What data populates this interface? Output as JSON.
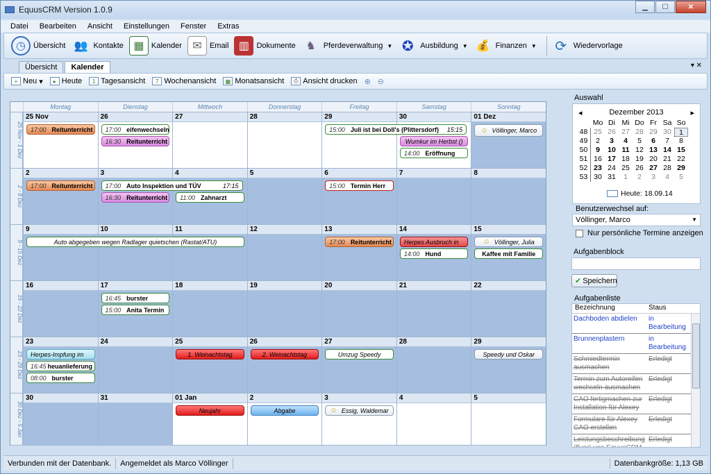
{
  "window": {
    "title": "EquusCRM  Version 1.0.9"
  },
  "menu": [
    "Datei",
    "Bearbeiten",
    "Ansicht",
    "Einstellungen",
    "Fenster",
    "Extras"
  ],
  "toolbar": {
    "items": [
      "Übersicht",
      "Kontakte",
      "Kalender",
      "Email",
      "Dokumente",
      "Pferdeverwaltung",
      "Ausbildung",
      "Finanzen",
      "Wiedervorlage"
    ]
  },
  "tabs": [
    "Übersicht",
    "Kalender"
  ],
  "subtoolbar": [
    "Neu",
    "Heute",
    "Tagesansicht",
    "Wochenansicht",
    "Monatsansicht",
    "Ansicht drucken"
  ],
  "calendar": {
    "weekdays": [
      "Montag",
      "Dienstag",
      "Mittwoch",
      "Donnerstag",
      "Freitag",
      "Samstag",
      "Sonntag"
    ],
    "weeks": [
      {
        "label": "25 Nov - 1 Dez",
        "days": [
          "25 Nov",
          "26",
          "27",
          "28",
          "29",
          "30",
          "01 Dez"
        ]
      },
      {
        "label": "2 - 8 Dez",
        "days": [
          "2",
          "3",
          "4",
          "5",
          "6",
          "7",
          "8"
        ]
      },
      {
        "label": "9 - 15 Dez",
        "days": [
          "9",
          "10",
          "11",
          "12",
          "13",
          "14",
          "15"
        ]
      },
      {
        "label": "16 - 22 Dez",
        "days": [
          "16",
          "17",
          "18",
          "19",
          "20",
          "21",
          "22"
        ]
      },
      {
        "label": "23 - 29 Dez",
        "days": [
          "23",
          "24",
          "25",
          "26",
          "27",
          "28",
          "29"
        ]
      },
      {
        "label": "30 Dez - 5 Jan",
        "days": [
          "30",
          "31",
          "01 Jan",
          "2",
          "3",
          "4",
          "5"
        ]
      }
    ],
    "events": {
      "w0_mo": {
        "time": "17:00",
        "text": "Reitunterricht"
      },
      "w0_di1": {
        "time": "17:00",
        "text": "eifenwechseln"
      },
      "w0_di2": {
        "time": "16:30",
        "text": "Reitunterricht"
      },
      "w0_fr": {
        "time": "15:00",
        "text": "Juli ist bei Doll's (Plittersdorf)",
        "end": "15:15"
      },
      "w0_sa1": {
        "text": "Wumkur im Herbst ()"
      },
      "w0_sa2": {
        "time": "14:00",
        "text": "Eröffnung"
      },
      "w0_so": {
        "text": "Völlinger, Marco"
      },
      "w1_mo": {
        "time": "17:00",
        "text": "Reitunterricht"
      },
      "w1_di1": {
        "time": "17:00",
        "text": "Auto Inspektion und TÜV",
        "end": "17:15"
      },
      "w1_di2": {
        "time": "16:30",
        "text": "Reitunterricht"
      },
      "w1_mi": {
        "time": "11:00",
        "text": "Zahnarzt"
      },
      "w1_fr": {
        "time": "15:00",
        "text": "Termin Herr"
      },
      "w2_span": {
        "text": "Auto abgegeben wegen Radlager quietschen (Rastat/ATU)"
      },
      "w2_fr": {
        "time": "17:00",
        "text": "Reitunterricht"
      },
      "w2_sa1": {
        "text": "Herpes Ausbruch in"
      },
      "w2_sa2": {
        "time": "14:00",
        "text": "Hund"
      },
      "w2_so1": {
        "text": "Völlinger, Julia"
      },
      "w2_so2": {
        "text": "Kaffee mit Familie"
      },
      "w3_di1": {
        "time": "16:45",
        "text": "burster"
      },
      "w3_di2": {
        "time": "15:00",
        "text": "Anita Termin"
      },
      "w4_mo1": {
        "text": "Herpes-Impfung im"
      },
      "w4_mo2": {
        "time": "16:45",
        "text": "heuanlieferung"
      },
      "w4_mo3": {
        "time": "08:00",
        "text": "burster"
      },
      "w4_mi": {
        "text": "1. Weinachtstag"
      },
      "w4_do": {
        "text": "2. Weinachtstag"
      },
      "w4_fr": {
        "text": "Umzug Speedy"
      },
      "w4_so": {
        "text": "Speedy und Oskar"
      },
      "w5_mi": {
        "text": "Neujahr"
      },
      "w5_do": {
        "text": "Abgabe"
      },
      "w5_fr": {
        "text": "Essig, Waldemar"
      }
    }
  },
  "sidebar": {
    "auswahl": "Auswahl",
    "month": "Dezember 2013",
    "mini_headers": [
      "Mo",
      "Di",
      "Mi",
      "Do",
      "Fr",
      "Sa",
      "So"
    ],
    "mini_rows": [
      {
        "wk": "48",
        "d": [
          "25",
          "26",
          "27",
          "28",
          "29",
          "30",
          "1"
        ]
      },
      {
        "wk": "49",
        "d": [
          "2",
          "3",
          "4",
          "5",
          "6",
          "7",
          "8"
        ]
      },
      {
        "wk": "50",
        "d": [
          "9",
          "10",
          "11",
          "12",
          "13",
          "14",
          "15"
        ]
      },
      {
        "wk": "51",
        "d": [
          "16",
          "17",
          "18",
          "19",
          "20",
          "21",
          "22"
        ]
      },
      {
        "wk": "52",
        "d": [
          "23",
          "24",
          "25",
          "26",
          "27",
          "28",
          "29"
        ]
      },
      {
        "wk": "53",
        "d": [
          "30",
          "31",
          "1",
          "2",
          "3",
          "4",
          "5"
        ]
      }
    ],
    "today": "Heute: 18.09.14",
    "user_label": "Benutzerwechsel auf:",
    "user_value": "Völlinger, Marco",
    "only_personal": "Nur persönliche Termine anzeigen",
    "taskblock": "Aufgabenblock",
    "save": "Speichern",
    "tasklist": "Aufgabenliste",
    "task_headers": [
      "Bezeichnung",
      "Staus"
    ],
    "tasks": [
      {
        "name": "Dachboden abdielen",
        "status": "in Bearbeitung",
        "state": "active"
      },
      {
        "name": "Brunnenplastern",
        "status": "in Bearbeitung",
        "state": "active"
      },
      {
        "name": "Schmiedtermin ausmachen",
        "status": "Erledigt",
        "state": "done"
      },
      {
        "name": "Termin zum Autoreifen wechseln ausmachen",
        "status": "Erledigt",
        "state": "done"
      },
      {
        "name": "CAO fertigmachen zur Installation für Alexey",
        "status": "Erledigt",
        "state": "done"
      },
      {
        "name": "Formulare für Alexey CAO erstellen",
        "status": "Erledigt",
        "state": "done"
      },
      {
        "name": "Leistungsbeschreibung (flyer) von EquusCRM fertig machen",
        "status": "Erledigt",
        "state": "done"
      }
    ]
  },
  "status": {
    "db": "Verbunden mit der Datenbank.",
    "user": "Angemeldet als Marco Völlinger",
    "size": "Datenbankgröße: 1,13 GB"
  }
}
